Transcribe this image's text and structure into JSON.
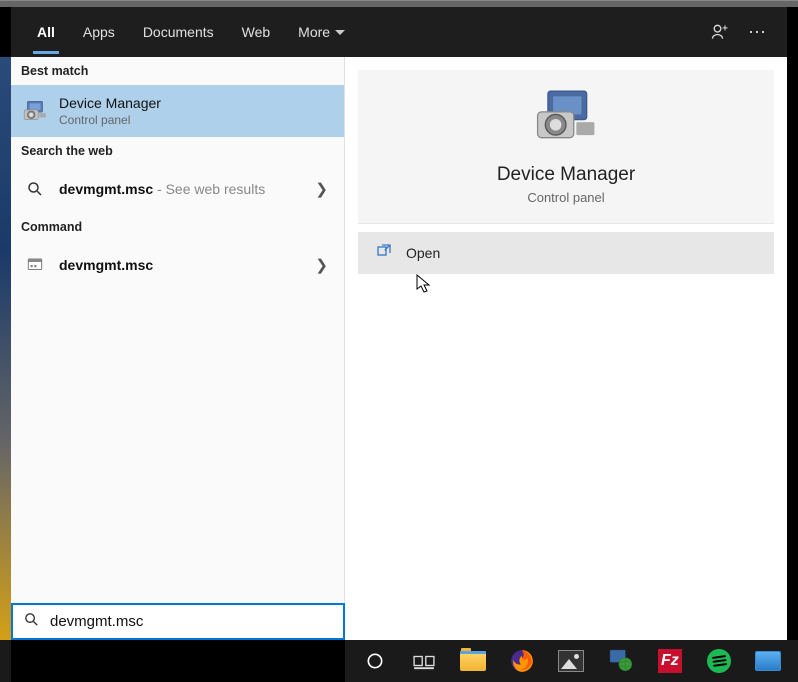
{
  "tabs": {
    "all": "All",
    "apps": "Apps",
    "documents": "Documents",
    "web": "Web",
    "more": "More"
  },
  "sections": {
    "best_match": "Best match",
    "search_web": "Search the web",
    "command": "Command"
  },
  "best_match": {
    "title": "Device Manager",
    "sub": "Control panel"
  },
  "web_result": {
    "query": "devmgmt.msc",
    "suffix": " - See web results"
  },
  "command_result": {
    "label": "devmgmt.msc"
  },
  "preview": {
    "title": "Device Manager",
    "sub": "Control panel",
    "action": "Open"
  },
  "search": {
    "value": "devmgmt.msc"
  },
  "taskbar": {
    "fz": "Fz"
  }
}
